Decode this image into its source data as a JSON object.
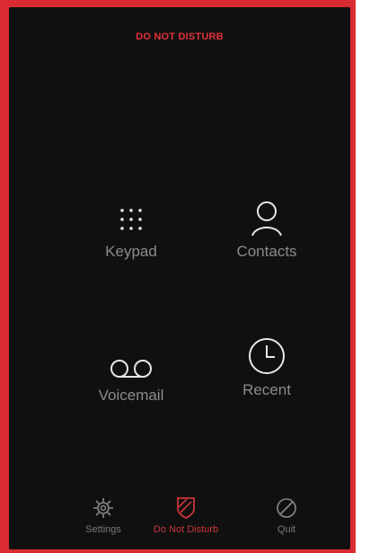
{
  "status_banner": "DO NOT DISTURB",
  "tiles": [
    {
      "label": "Keypad",
      "icon": "keypad-icon"
    },
    {
      "label": "Contacts",
      "icon": "contacts-icon"
    },
    {
      "label": "Voicemail",
      "icon": "voicemail-icon"
    },
    {
      "label": "Recent",
      "icon": "clock-icon"
    }
  ],
  "bottom_bar": [
    {
      "label": "Settings",
      "icon": "gear-icon"
    },
    {
      "label": "Do Not Disturb",
      "icon": "shield-icon",
      "active": true
    },
    {
      "label": "Quit",
      "icon": "quit-icon"
    }
  ],
  "colors": {
    "frame": "#d92b31",
    "screen": "#101010",
    "accent": "#e0323a",
    "muted": "#8a8a8a"
  }
}
